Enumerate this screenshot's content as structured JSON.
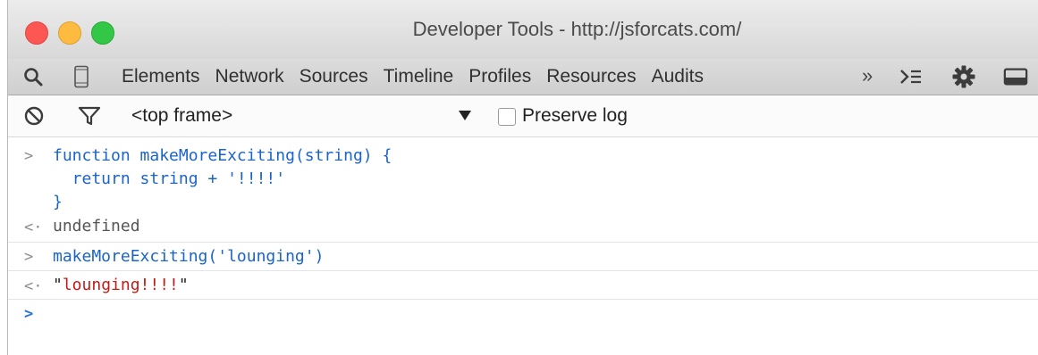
{
  "window": {
    "title": "Developer Tools - http://jsforcats.com/"
  },
  "tabbar": {
    "tabs": [
      "Elements",
      "Network",
      "Sources",
      "Timeline",
      "Profiles",
      "Resources",
      "Audits"
    ],
    "overflow_label": "»"
  },
  "console_toolbar": {
    "frame_selector": "<top frame>",
    "preserve_log_label": "Preserve log",
    "preserve_log_checked": false
  },
  "console": {
    "input1_line1": "function makeMoreExciting(string) {",
    "input1_line2": "  return string + '!!!!'",
    "input1_line3": "}",
    "output1": "undefined",
    "input2": "makeMoreExciting('lounging')",
    "output2_quote_open": "\"",
    "output2_value": "lounging!!!!",
    "output2_quote_close": "\""
  },
  "colors": {
    "close": "#fc5753",
    "minimize": "#fdbc40",
    "maximize": "#33c748",
    "code_blue": "#1b64c9",
    "string_red": "#c41a16"
  },
  "icons": {
    "search": "search-icon",
    "device": "device-mode-icon",
    "drawer": "show-drawer-icon",
    "settings": "gear-icon",
    "dock": "dock-icon",
    "clear": "clear-console-icon",
    "filter": "filter-icon"
  }
}
